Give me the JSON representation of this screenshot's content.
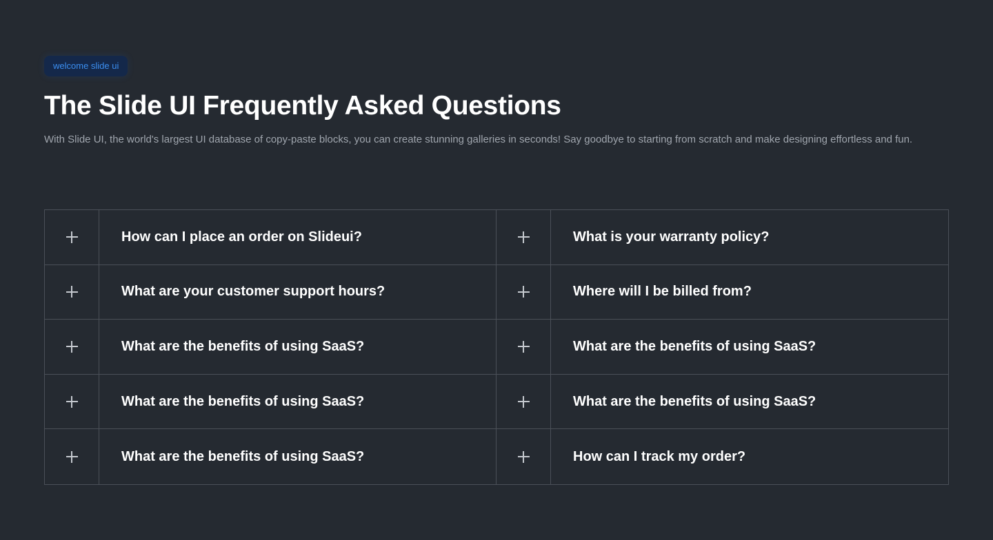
{
  "header": {
    "badge": "welcome slide ui",
    "title": "The Slide UI Frequently Asked Questions",
    "description": "With Slide UI, the world's largest UI database of copy-paste blocks, you can create stunning galleries in seconds! Say goodbye to starting from scratch and make designing effortless and fun."
  },
  "faq": {
    "toggle_icon": "plus-icon",
    "items": [
      {
        "question": "How can I place an order on Slideui?"
      },
      {
        "question": "What is your warranty policy?"
      },
      {
        "question": "What are your customer support hours?"
      },
      {
        "question": "Where will I be billed from?"
      },
      {
        "question": "What are the benefits of using SaaS?"
      },
      {
        "question": "What are the benefits of using SaaS?"
      },
      {
        "question": "What are the benefits of using SaaS?"
      },
      {
        "question": "What are the benefits of using SaaS?"
      },
      {
        "question": "What are the benefits of using SaaS?"
      },
      {
        "question": "How can I track my order?"
      }
    ]
  },
  "colors": {
    "background": "#252a31",
    "border": "#4b5058",
    "badge_bg": "#14284a",
    "badge_text": "#3b8ef0",
    "text_primary": "#ffffff",
    "text_secondary": "#a0a6ae"
  }
}
